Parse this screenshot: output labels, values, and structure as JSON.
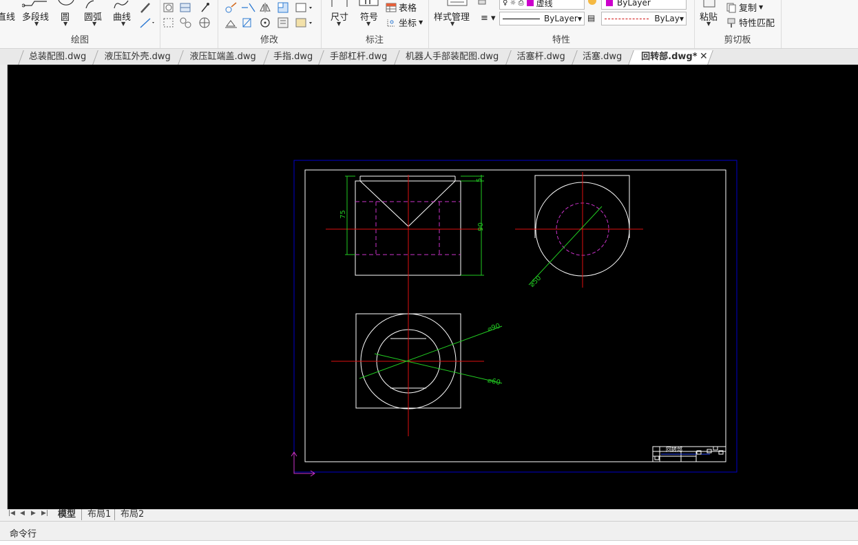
{
  "ribbon": {
    "draw": {
      "title": "绘图",
      "line": "直线",
      "polyline": "多段线",
      "circle": "圆",
      "arc": "圆弧",
      "curve": "曲线"
    },
    "modify": {
      "title": "修改"
    },
    "annotate": {
      "title": "标注",
      "dimension": "尺寸",
      "symbol": "符号",
      "table": "表格",
      "coordinate": "坐标"
    },
    "properties": {
      "title": "特性",
      "style_manager": "样式管理",
      "layer_name": "ByLayer",
      "lineweight": "ByLayer",
      "linetype": "ByLay",
      "top_color_text": "ByLayer",
      "top_layer_text": "虚线"
    },
    "clipboard": {
      "title": "剪切板",
      "paste": "粘贴",
      "copy": "复制",
      "match": "特性匹配"
    }
  },
  "file_tabs": [
    {
      "label": "总装配图.dwg"
    },
    {
      "label": "液压缸外壳.dwg"
    },
    {
      "label": "液压缸端盖.dwg"
    },
    {
      "label": "手指.dwg"
    },
    {
      "label": "手部杠杆.dwg"
    },
    {
      "label": "机器人手部装配图.dwg"
    },
    {
      "label": "活塞杆.dwg"
    },
    {
      "label": "活塞.dwg"
    },
    {
      "label": "回转部.dwg*"
    }
  ],
  "drawing": {
    "dims": {
      "top5": "5",
      "left75": "75",
      "right90": "90",
      "dia50_side": "⌀50",
      "dia90": "⌀90",
      "dia60": "⌀60"
    },
    "title_block": "回转部"
  },
  "layout_tabs": {
    "model": "模型",
    "layout1": "布局1",
    "layout2": "布局2"
  },
  "command": {
    "label": "命令行"
  },
  "colors": {
    "canvas": "#000000",
    "border_outer": "#0000cc",
    "border_inner": "#ffffff",
    "center_line": "#e01010",
    "hidden_line": "#cc33cc",
    "dimension": "#22cc22",
    "ucs": "#cc33cc"
  }
}
